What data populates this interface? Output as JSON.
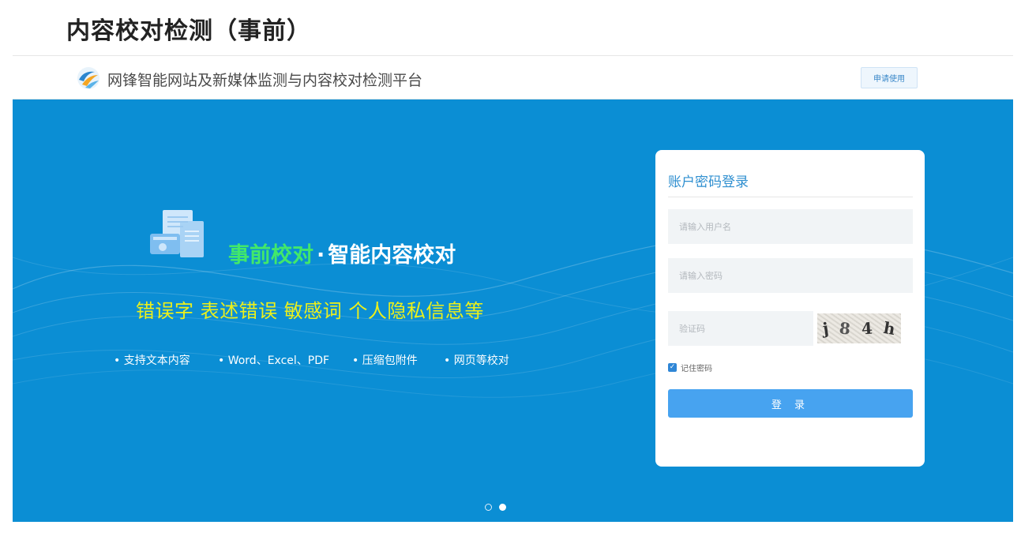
{
  "page": {
    "title": "内容校对检测（事前）"
  },
  "topbar": {
    "site_title": "网锋智能网站及新媒体监测与内容校对检测平台",
    "apply_label": "申请使用",
    "logo_icon": "wangfeng-logo-icon"
  },
  "banner": {
    "headline_green": "事前校对",
    "headline_dot": "·",
    "headline_white": "智能内容校对",
    "subline": "错误字 表述错误 敏感词 个人隐私信息等",
    "features": [
      "• 支持文本内容",
      "• Word、Excel、PDF",
      "• 压缩包附件",
      "• 网页等校对"
    ],
    "doc_icon": "document-stack-icon",
    "carousel_active_index": 2,
    "carousel_count": 2
  },
  "login": {
    "title": "账户密码登录",
    "username_placeholder": "请输入用户名",
    "password_placeholder": "请输入密码",
    "code_placeholder": "验证码",
    "captcha_chars": [
      "j",
      "8",
      "4",
      "h"
    ],
    "remember_label": "记住密码",
    "remember_checked": true,
    "submit_label": "登 录"
  },
  "colors": {
    "banner_bg": "#0b8ed4",
    "headline_green": "#42e86a",
    "subline_yellow": "#ecf01b",
    "login_accent": "#2f8fd0",
    "login_button": "#47a3f0"
  }
}
